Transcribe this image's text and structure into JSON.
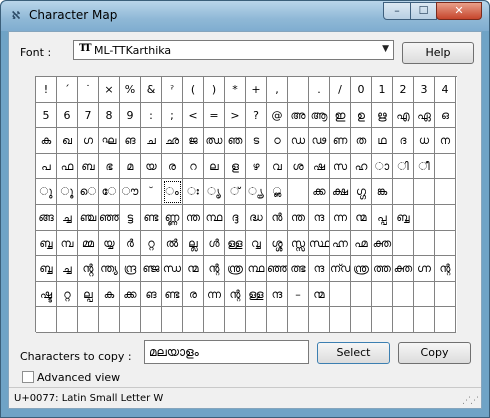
{
  "window": {
    "title": "Character Map",
    "minimize": "–",
    "maximize": "☐",
    "close": "✕"
  },
  "font": {
    "label": "Font :",
    "value": "ML-TTKarthika",
    "icon": "truetype-icon"
  },
  "buttons": {
    "help": "Help",
    "select": "Select",
    "copy": "Copy"
  },
  "copy_field": {
    "label": "Characters to copy :",
    "value": "മലയാളം"
  },
  "advanced_view": {
    "label": "Advanced view",
    "checked": false
  },
  "status": "U+0077: Latin Small Letter W",
  "grid": {
    "columns": 20,
    "selected_index": 86,
    "rows": [
      [
        "!",
        "ˊ",
        "˙",
        "×",
        "%",
        "&",
        "ˀ",
        "(",
        ")",
        "*",
        "+",
        ",",
        "",
        ".",
        "/",
        "0",
        "1",
        "2",
        "3",
        "4"
      ],
      [
        "5",
        "6",
        "7",
        "8",
        "9",
        ":",
        ";",
        "<",
        "=",
        ">",
        "?",
        "@",
        "അ",
        "ആ",
        "ഇ",
        "ഉ",
        "ഋ",
        "എ",
        "ഏ",
        "ഒ"
      ],
      [
        "ക",
        "ഖ",
        "ഗ",
        "ഘ",
        "ങ",
        "ച",
        "ഛ",
        "ജ",
        "ഝ",
        "ഞ",
        "ട",
        "ഠ",
        "ഡ",
        "ഢ",
        "ണ",
        "ത",
        "ഥ",
        "ദ",
        "ധ",
        "ന"
      ],
      [
        "പ",
        "ഫ",
        "ബ",
        "ഭ",
        "മ",
        "യ",
        "ര",
        "റ",
        "ല",
        "ള",
        "ഴ",
        "വ",
        "ശ",
        "ഷ",
        "സ",
        "ഹ",
        "ാ",
        "ി",
        "ീ",
        ""
      ],
      [
        "ു",
        "ൂ",
        "െ",
        "േ",
        "ൗ",
        "˘",
        "ം",
        "ഃ",
        "ൃ",
        "്",
        "ൄ",
        "ൢ",
        "",
        "ക്ക",
        "ക്ഷ",
        "ഗ്ഗ",
        "ങ്ക",
        "",
        "",
        ""
      ],
      [
        "ങ്ങ",
        "ച്ച",
        "ഞ്ച",
        "ഞ്ഞ",
        "ട്ട",
        "ണ്ട",
        "ണ്ണ",
        "ന്ത",
        "ന്ഥ",
        "ദ്ദ",
        "ദ്ധ",
        "ൻ",
        "ന്ത",
        "ന്ദ",
        "ന്ന",
        "ന്മ",
        "പ്പ",
        "ബ്ബ",
        "",
        ""
      ],
      [
        "ബ്ബ",
        "മ്പ",
        "മ്മ",
        "യ്യ",
        "ർ",
        "റ്റ",
        "ൽ",
        "ല്ല",
        "ൾ",
        "ള്ള",
        "വ്വ",
        "ശ്ശ",
        "സ്സ",
        "സ്ഥ",
        "ഹ്ന",
        "ഹ്മ",
        "ക്ത",
        "",
        "",
        ""
      ],
      [
        "ബ്ബ",
        "ച്ച",
        "ൻ്റ",
        "ന്ത്യ",
        "ന്ദ്ര",
        "ഞ്ജ",
        "ന്ധ",
        "ന്മ",
        "ന്റ",
        "ന്ത്ര",
        "ന്ഥ",
        "ഞ്ഞ",
        "ത്ഭ",
        "ന്ദ",
        "ന്ഡ",
        "ന്ത്ര",
        "ത്ത",
        "ക്ത",
        "ഗ്ന",
        "ന്റ"
      ],
      [
        "ഷ്ട",
        "റ്റ",
        "ല്പ",
        "ക",
        "ക്ക",
        "ങ",
        "ണ്ട",
        "ര",
        "ന്ന",
        "ന്റ",
        "ള്ള",
        "ന്ദ",
        "–",
        "ന്മ",
        "",
        "",
        "",
        "",
        "",
        ""
      ],
      [
        "",
        "",
        "",
        "",
        "",
        "",
        "",
        "",
        "",
        "",
        "",
        "",
        "",
        "",
        "",
        "",
        "",
        "",
        "",
        ""
      ]
    ]
  }
}
